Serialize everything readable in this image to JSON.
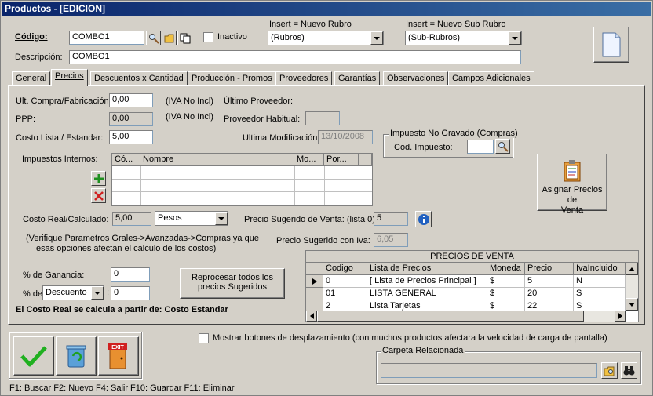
{
  "window": {
    "title": "Productos - [EDICION]"
  },
  "header": {
    "codigo_label": "Código:",
    "codigo_value": "COMBO1",
    "inactivo_label": "Inactivo",
    "rubro_hint": "Insert = Nuevo Rubro",
    "rubro_value": "(Rubros)",
    "subrubro_hint": "Insert = Nuevo Sub Rubro",
    "subrubro_value": "(Sub-Rubros)",
    "descripcion_label": "Descripción:",
    "descripcion_value": "COMBO1"
  },
  "tabs": [
    {
      "label": "General"
    },
    {
      "label": "Precios"
    },
    {
      "label": "Descuentos x Cantidad"
    },
    {
      "label": "Producción - Promos"
    },
    {
      "label": "Proveedores"
    },
    {
      "label": "Garantías"
    },
    {
      "label": "Observaciones"
    },
    {
      "label": "Campos Adicionales"
    }
  ],
  "precios": {
    "ult_compra_label": "Ult. Compra/Fabricación:",
    "ult_compra_value": "0,00",
    "iva_no_incl_1": "(IVA No Incl)",
    "ultimo_proveedor_label": "Último Proveedor:",
    "ppp_label": "PPP:",
    "ppp_value": "0,00",
    "iva_no_incl_2": "(IVA No Incl)",
    "proveedor_habitual_label": "Proveedor Habitual:",
    "costo_lista_label": "Costo Lista / Estandar:",
    "costo_lista_value": "5,00",
    "ultima_mod_label": "Ultima Modificación:",
    "ultima_mod_value": "13/10/2008",
    "impuesto_ng_title": "Impuesto No Gravado (Compras)",
    "cod_impuesto_label": "Cod. Impuesto:",
    "impuestos_internos_label": "Impuestos Internos:",
    "imp_columns": [
      "Có...",
      "Nombre",
      "Mo...",
      "Por..."
    ],
    "asignar_label_1": "Asignar Precios de",
    "asignar_label_2": "Venta",
    "costo_real_label": "Costo Real/Calculado:",
    "costo_real_value": "5,00",
    "moneda_value": "Pesos",
    "precio_sugerido_label": "Precio Sugerido de Venta: (lista 0)",
    "precio_sugerido_value": "5",
    "verifique_1": "(Verifique Parametros Grales->Avanzadas->Compras ya que",
    "verifique_2": "esas opciones afectan el calculo de los costos)",
    "precio_sug_iva_label": "Precio Sugerido con Iva:",
    "precio_sug_iva_value": "6,05",
    "ganancia_label": "% de Ganancia:",
    "ganancia_value": "0",
    "pct_de_label": "% de",
    "descuento_option": "Descuento",
    "descuento_value": "0",
    "reprocesar_1": "Reprocesar todos los",
    "reprocesar_2": "precios Sugeridos",
    "costo_real_note": "El Costo Real se calcula a partir de: Costo Estandar"
  },
  "precios_venta": {
    "title": "PRECIOS DE VENTA",
    "columns": [
      "Codigo",
      "Lista de Precios",
      "Moneda",
      "Precio",
      "IvaIncluido"
    ],
    "rows": [
      [
        "0",
        "[ Lista de Precios Principal ]",
        "$",
        "5",
        "N"
      ],
      [
        "01",
        "LISTA GENERAL",
        "$",
        "20",
        "S"
      ],
      [
        "2",
        "Lista Tarjetas",
        "$",
        "22",
        "S"
      ]
    ]
  },
  "footer": {
    "mostrar_botones": "Mostrar botones de desplazamiento  (con muchos productos afectara la velocidad de carga de pantalla)",
    "carpeta_label": "Carpeta Relacionada",
    "exit_label": "EXIT",
    "shortcuts": "F1: Buscar  F2: Nuevo  F4: Salir  F10: Guardar  F11: Eliminar"
  }
}
